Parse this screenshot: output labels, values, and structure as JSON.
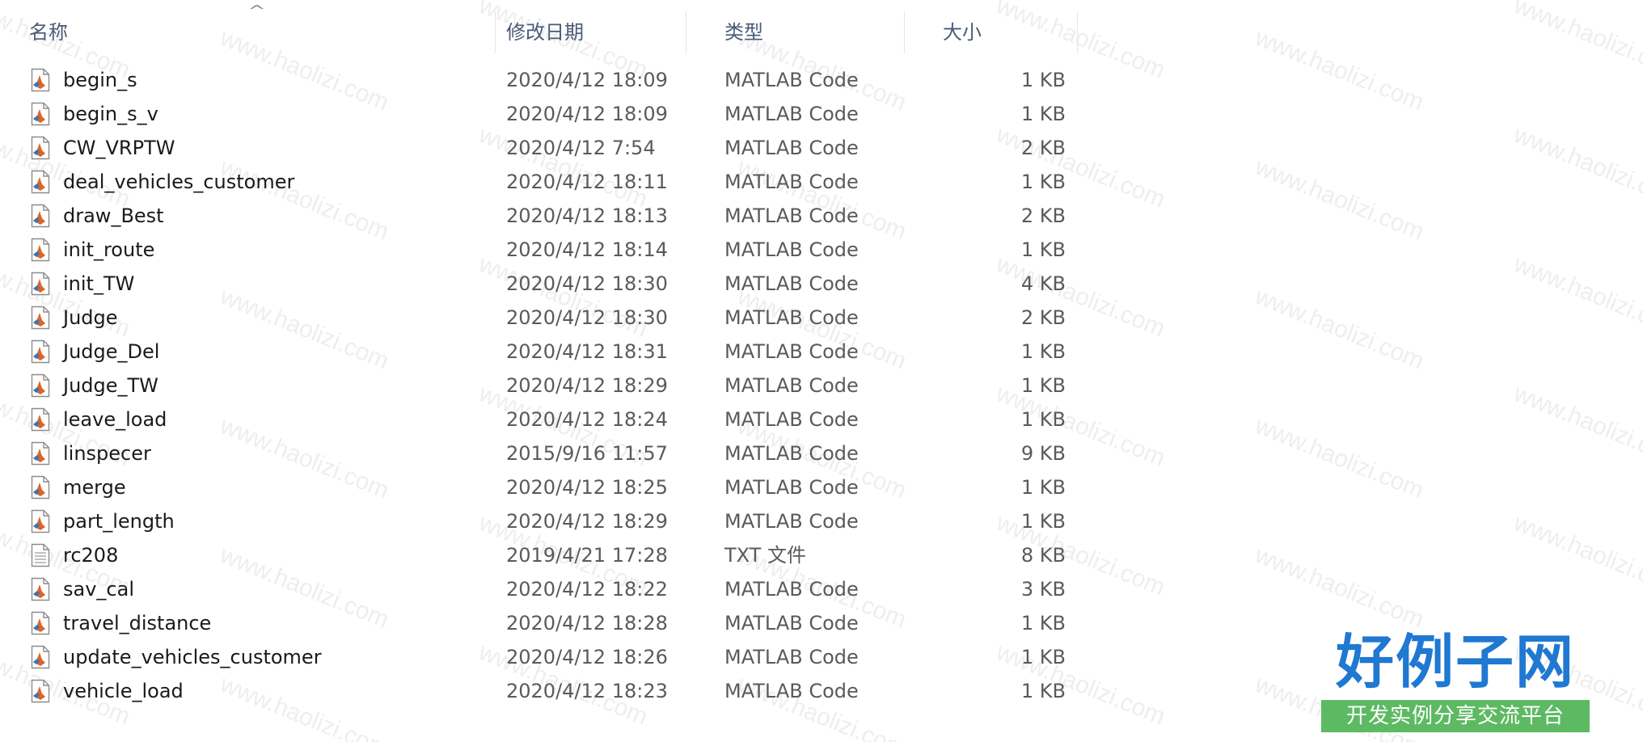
{
  "columns": {
    "name": "名称",
    "date": "修改日期",
    "type": "类型",
    "size": "大小"
  },
  "sort_indicator": "^",
  "files": [
    {
      "name": "begin_s",
      "date": "2020/4/12 18:09",
      "type": "MATLAB Code",
      "size": "1 KB",
      "icon": "matlab-file-icon"
    },
    {
      "name": "begin_s_v",
      "date": "2020/4/12 18:09",
      "type": "MATLAB Code",
      "size": "1 KB",
      "icon": "matlab-file-icon"
    },
    {
      "name": "CW_VRPTW",
      "date": "2020/4/12 7:54",
      "type": "MATLAB Code",
      "size": "2 KB",
      "icon": "matlab-file-icon"
    },
    {
      "name": "deal_vehicles_customer",
      "date": "2020/4/12 18:11",
      "type": "MATLAB Code",
      "size": "1 KB",
      "icon": "matlab-file-icon"
    },
    {
      "name": "draw_Best",
      "date": "2020/4/12 18:13",
      "type": "MATLAB Code",
      "size": "2 KB",
      "icon": "matlab-file-icon"
    },
    {
      "name": "init_route",
      "date": "2020/4/12 18:14",
      "type": "MATLAB Code",
      "size": "1 KB",
      "icon": "matlab-file-icon"
    },
    {
      "name": "init_TW",
      "date": "2020/4/12 18:30",
      "type": "MATLAB Code",
      "size": "4 KB",
      "icon": "matlab-file-icon"
    },
    {
      "name": "Judge",
      "date": "2020/4/12 18:30",
      "type": "MATLAB Code",
      "size": "2 KB",
      "icon": "matlab-file-icon"
    },
    {
      "name": "Judge_Del",
      "date": "2020/4/12 18:31",
      "type": "MATLAB Code",
      "size": "1 KB",
      "icon": "matlab-file-icon"
    },
    {
      "name": "Judge_TW",
      "date": "2020/4/12 18:29",
      "type": "MATLAB Code",
      "size": "1 KB",
      "icon": "matlab-file-icon"
    },
    {
      "name": "leave_load",
      "date": "2020/4/12 18:24",
      "type": "MATLAB Code",
      "size": "1 KB",
      "icon": "matlab-file-icon"
    },
    {
      "name": "linspecer",
      "date": "2015/9/16 11:57",
      "type": "MATLAB Code",
      "size": "9 KB",
      "icon": "matlab-file-icon"
    },
    {
      "name": "merge",
      "date": "2020/4/12 18:25",
      "type": "MATLAB Code",
      "size": "1 KB",
      "icon": "matlab-file-icon"
    },
    {
      "name": "part_length",
      "date": "2020/4/12 18:29",
      "type": "MATLAB Code",
      "size": "1 KB",
      "icon": "matlab-file-icon"
    },
    {
      "name": "rc208",
      "date": "2019/4/21 17:28",
      "type": "TXT 文件",
      "size": "8 KB",
      "icon": "text-file-icon"
    },
    {
      "name": "sav_cal",
      "date": "2020/4/12 18:22",
      "type": "MATLAB Code",
      "size": "3 KB",
      "icon": "matlab-file-icon"
    },
    {
      "name": "travel_distance",
      "date": "2020/4/12 18:28",
      "type": "MATLAB Code",
      "size": "1 KB",
      "icon": "matlab-file-icon"
    },
    {
      "name": "update_vehicles_customer",
      "date": "2020/4/12 18:26",
      "type": "MATLAB Code",
      "size": "1 KB",
      "icon": "matlab-file-icon"
    },
    {
      "name": "vehicle_load",
      "date": "2020/4/12 18:23",
      "type": "MATLAB Code",
      "size": "1 KB",
      "icon": "matlab-file-icon"
    }
  ],
  "watermark": {
    "text": "www.haolizi.com",
    "logo_title": "好例子网",
    "logo_subtitle": "开发实例分享交流平台"
  },
  "colors": {
    "header_text": "#4a5a78",
    "name_text": "#1a1a1a",
    "detail_text": "#5a5a5a",
    "logo_blue": "#1f78d1",
    "logo_green": "#5dba63"
  }
}
